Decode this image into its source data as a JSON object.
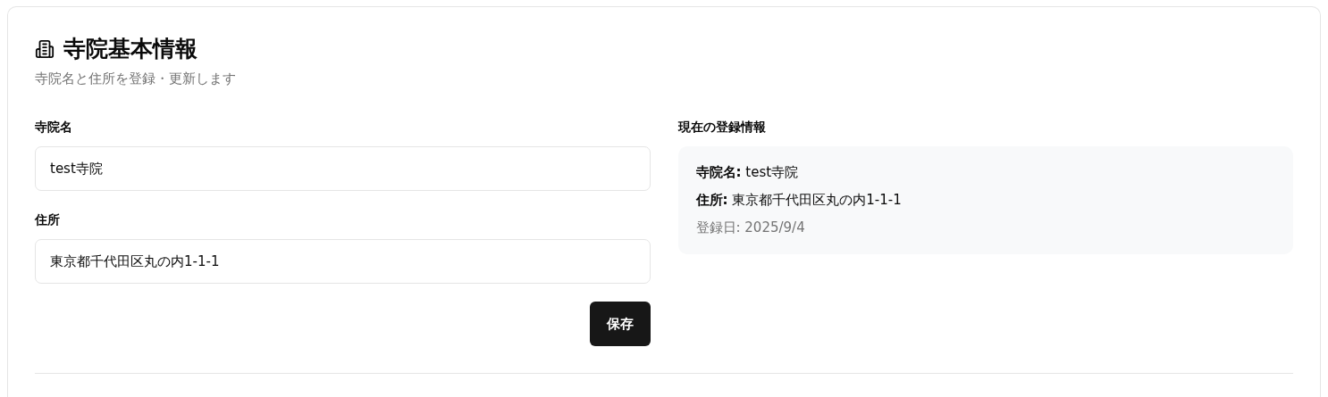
{
  "header": {
    "title": "寺院基本情報",
    "subtitle": "寺院名と住所を登録・更新します"
  },
  "form": {
    "fields": [
      {
        "label": "寺院名",
        "value": "test寺院"
      },
      {
        "label": "住所",
        "value": "東京都千代田区丸の内1-1-1"
      }
    ],
    "save_button": "保存"
  },
  "current": {
    "heading": "現在の登録情報",
    "lines": [
      {
        "kind": "main",
        "text": "**寺院名:** test寺院"
      },
      {
        "kind": "main",
        "text": "**住所:** 東京都千代田区丸の内1-1-1"
      },
      {
        "kind": "muted",
        "text": "登録日: 2025/9/4"
      }
    ]
  }
}
